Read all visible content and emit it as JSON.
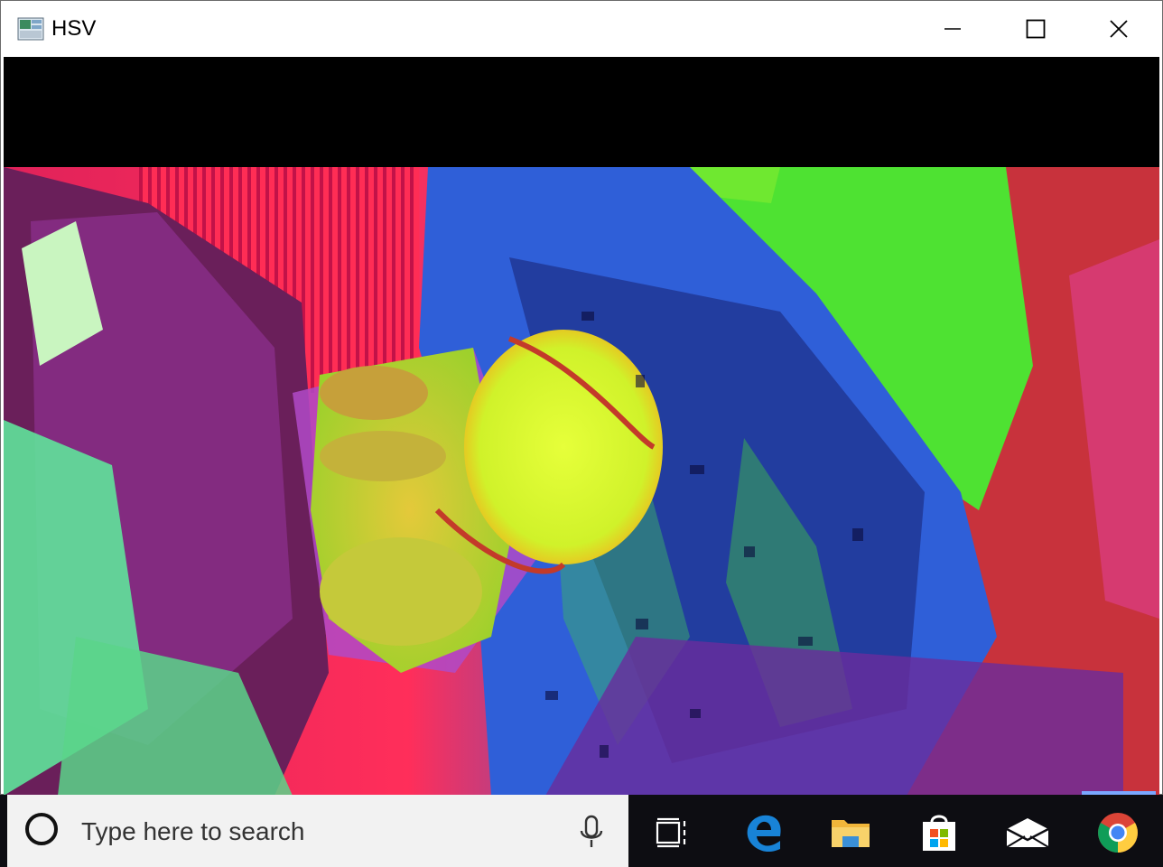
{
  "window": {
    "title": "HSV",
    "controls": [
      "minimize",
      "maximize",
      "close"
    ]
  },
  "taskbar": {
    "search_placeholder": "Type here to search",
    "pinned": [
      {
        "name": "task-view",
        "icon": "task-view-icon"
      },
      {
        "name": "edge",
        "icon": "edge-icon"
      },
      {
        "name": "file-explorer",
        "icon": "folder-icon"
      },
      {
        "name": "store",
        "icon": "store-icon"
      },
      {
        "name": "mail",
        "icon": "mail-icon"
      },
      {
        "name": "chrome",
        "icon": "chrome-icon"
      }
    ],
    "active_app": "chrome"
  },
  "colors": {
    "taskbar_bg": "#0d0d12",
    "search_bg": "#f2f2f2",
    "edge_blue": "#0078d7",
    "folder_yellow": "#f8c441"
  }
}
